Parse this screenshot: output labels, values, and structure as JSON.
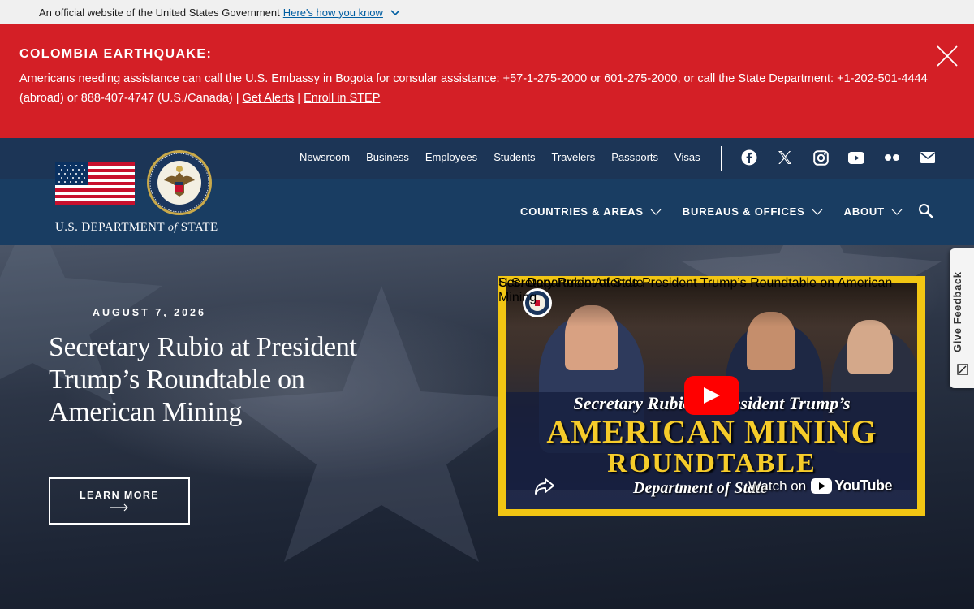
{
  "gov_banner": {
    "text": "An official website of the United States Government",
    "link": "Here's how you know"
  },
  "alert": {
    "title": "COLOMBIA EARTHQUAKE:",
    "message": "Americans needing assistance can call the U.S. Embassy in Bogota for consular assistance: +57-1-275-2000 or 601-275-2000, or call the State Department: +1-202-501-4444 (abroad) or 888-407-4747 (U.S./Canada) | ",
    "link1": "Get Alerts",
    "separator": " | ",
    "link2": "Enroll in STEP"
  },
  "logo": {
    "wordmark_pre": "U.S. DEPARTMENT ",
    "wordmark_of": "of",
    "wordmark_post": " STATE"
  },
  "util_nav": [
    "Newsroom",
    "Business",
    "Employees",
    "Students",
    "Travelers",
    "Passports",
    "Visas"
  ],
  "social": [
    "facebook-icon",
    "x-icon",
    "instagram-icon",
    "youtube-icon",
    "flickr-icon",
    "email-icon"
  ],
  "main_nav": [
    "COUNTRIES & AREAS",
    "BUREAUS & OFFICES",
    "ABOUT"
  ],
  "hero": {
    "date": "AUGUST 7, 2026",
    "title": "Secretary Rubio at President Trump’s Roundtable on American Mining",
    "button": "LEARN MORE"
  },
  "video": {
    "title": "Secretary Rubio Attends President Trump’s Roundtable on American Mining",
    "channel": "U.S. Department of State",
    "banner_line1": "Secretary Rubio at President Trump’s",
    "banner_line2": "AMERICAN MINING",
    "banner_line3": "ROUNDTABLE",
    "banner_line4": "Department of State",
    "watch_on": "Watch on",
    "youtube": "YouTube"
  },
  "feedback": {
    "label": "Give Feedback"
  },
  "colors": {
    "alert_red": "#d41f26",
    "header_blue": "#193d62",
    "header_top_blue": "#1c3556",
    "video_frame_yellow": "#f2c613",
    "banner_gold": "#f6cc2a"
  }
}
